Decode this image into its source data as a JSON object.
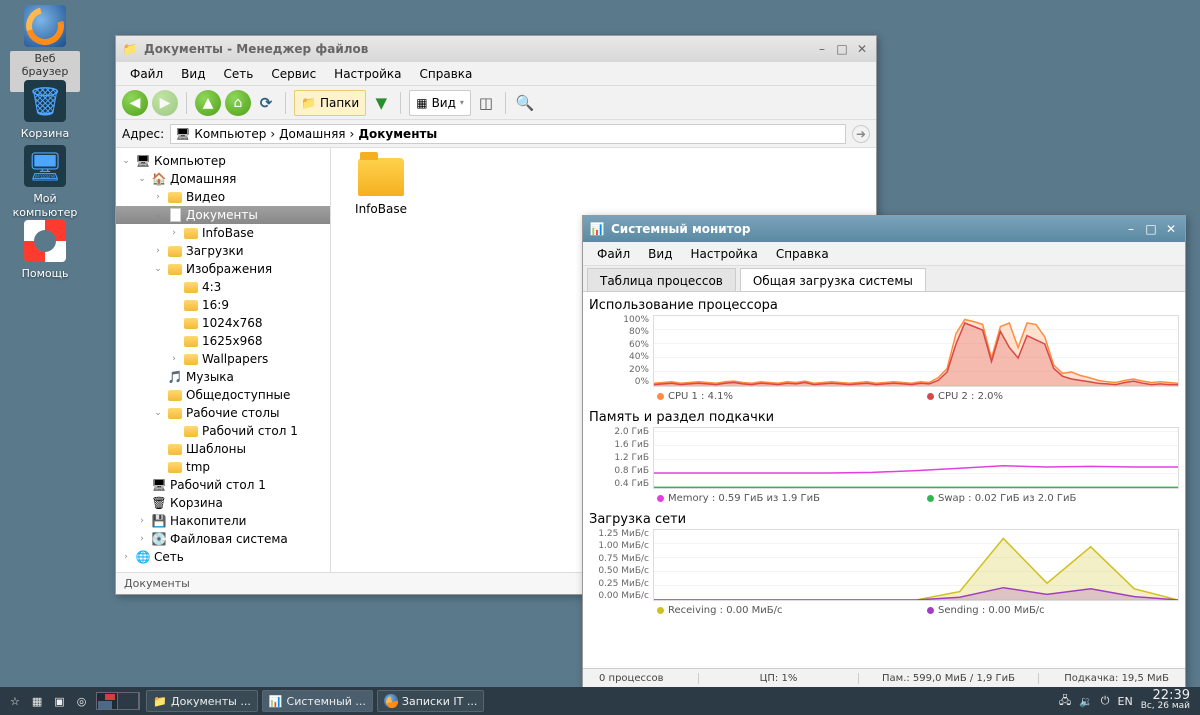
{
  "desktop_icons": [
    {
      "id": "firefox",
      "label": "Веб браузер\nFirefox",
      "selected": true
    },
    {
      "id": "trash",
      "label": "Корзина"
    },
    {
      "id": "computer",
      "label": "Мой\nкомпьютер"
    },
    {
      "id": "help",
      "label": "Помощь"
    }
  ],
  "fm": {
    "title": "Документы - Менеджер файлов",
    "menu": [
      "Файл",
      "Вид",
      "Сеть",
      "Сервис",
      "Настройка",
      "Справка"
    ],
    "folder_chip": "Папки",
    "view_chip": "Вид",
    "address_label": "Адрес:",
    "breadcrumb": [
      "Компьютер",
      "Домашняя",
      "Документы"
    ],
    "tree": [
      {
        "d": 0,
        "exp": "open",
        "icon": "comp",
        "label": "Компьютер"
      },
      {
        "d": 1,
        "exp": "open",
        "icon": "home",
        "label": "Домашняя"
      },
      {
        "d": 2,
        "exp": "closed",
        "icon": "folder",
        "label": "Видео"
      },
      {
        "d": 2,
        "exp": "open",
        "icon": "doc",
        "label": "Документы",
        "sel": true
      },
      {
        "d": 3,
        "exp": "closed",
        "icon": "folder",
        "label": "InfoBase"
      },
      {
        "d": 2,
        "exp": "closed",
        "icon": "folder",
        "label": "Загрузки"
      },
      {
        "d": 2,
        "exp": "open",
        "icon": "folder",
        "label": "Изображения"
      },
      {
        "d": 3,
        "exp": "leaf",
        "icon": "folder",
        "label": "4:3"
      },
      {
        "d": 3,
        "exp": "leaf",
        "icon": "folder",
        "label": "16:9"
      },
      {
        "d": 3,
        "exp": "leaf",
        "icon": "folder",
        "label": "1024x768"
      },
      {
        "d": 3,
        "exp": "leaf",
        "icon": "folder",
        "label": "1625x968"
      },
      {
        "d": 3,
        "exp": "closed",
        "icon": "folder",
        "label": "Wallpapers"
      },
      {
        "d": 2,
        "exp": "leaf",
        "icon": "music",
        "label": "Музыка"
      },
      {
        "d": 2,
        "exp": "leaf",
        "icon": "folder",
        "label": "Общедоступные"
      },
      {
        "d": 2,
        "exp": "open",
        "icon": "folder",
        "label": "Рабочие столы"
      },
      {
        "d": 3,
        "exp": "leaf",
        "icon": "folder",
        "label": "Рабочий стол 1"
      },
      {
        "d": 2,
        "exp": "leaf",
        "icon": "folder",
        "label": "Шаблоны"
      },
      {
        "d": 2,
        "exp": "leaf",
        "icon": "folder",
        "label": "tmp"
      },
      {
        "d": 1,
        "exp": "leaf",
        "icon": "desk",
        "label": "Рабочий стол 1"
      },
      {
        "d": 1,
        "exp": "leaf",
        "icon": "trash",
        "label": "Корзина"
      },
      {
        "d": 1,
        "exp": "closed",
        "icon": "drive",
        "label": "Накопители"
      },
      {
        "d": 1,
        "exp": "closed",
        "icon": "fs",
        "label": "Файловая система"
      },
      {
        "d": 0,
        "exp": "closed",
        "icon": "net",
        "label": "Сеть"
      }
    ],
    "files": [
      {
        "name": "InfoBase"
      }
    ],
    "status": "Документы"
  },
  "sm": {
    "title": "Системный монитор",
    "menu": [
      "Файл",
      "Вид",
      "Настройка",
      "Справка"
    ],
    "tabs": [
      "Таблица процессов",
      "Общая загрузка системы"
    ],
    "active_tab": 1,
    "cpu": {
      "title": "Использование процессора",
      "yticks": [
        "100%",
        "80%",
        "60%",
        "40%",
        "20%",
        "0%"
      ],
      "legend": [
        {
          "color": "#ff8c42",
          "label": "CPU 1 : 4.1%"
        },
        {
          "color": "#d94848",
          "label": "CPU 2 : 2.0%"
        }
      ]
    },
    "mem": {
      "title": "Память и раздел подкачки",
      "yticks": [
        "2.0 ГиБ",
        "1.6 ГиБ",
        "1.2 ГиБ",
        "0.8 ГиБ",
        "0.4 ГиБ"
      ],
      "legend": [
        {
          "color": "#e040e0",
          "label": "Memory : 0.59 ГиБ из 1.9 ГиБ"
        },
        {
          "color": "#2eb84f",
          "label": "Swap : 0.02 ГиБ из 2.0 ГиБ"
        }
      ]
    },
    "net": {
      "title": "Загрузка сети",
      "yticks": [
        "1.25 МиБ/с",
        "1.00 МиБ/с",
        "0.75 МиБ/с",
        "0.50 МиБ/с",
        "0.25 МиБ/с",
        "0.00 МиБ/с"
      ],
      "legend": [
        {
          "color": "#d0c020",
          "label": "Receiving : 0.00 МиБ/с"
        },
        {
          "color": "#a040c0",
          "label": "Sending : 0.00 МиБ/с"
        }
      ]
    },
    "status": {
      "procs": "0 процессов",
      "cpu": "ЦП: 1%",
      "mem": "Пам.: 599,0 МиБ / 1,9 ГиБ",
      "swap": "Подкачка: 19,5 МиБ"
    }
  },
  "taskbar": {
    "tasks": [
      {
        "icon": "doc",
        "label": "Документы ...",
        "active": false
      },
      {
        "icon": "mon",
        "label": "Системный ...",
        "active": true
      },
      {
        "icon": "ff",
        "label": "Записки IT ...",
        "active": false
      }
    ],
    "lang": "EN",
    "time": "22:39",
    "date": "Вс, 26 май"
  },
  "chart_data": [
    {
      "type": "line",
      "title": "Использование процессора",
      "ylabel": "%",
      "ylim": [
        0,
        100
      ],
      "x": [
        0,
        1,
        2,
        3,
        4,
        5,
        6,
        7,
        8,
        9,
        10,
        11,
        12,
        13,
        14,
        15,
        16,
        17,
        18,
        19,
        20,
        21,
        22,
        23,
        24,
        25,
        26,
        27,
        28,
        29,
        30,
        31,
        32,
        33,
        34,
        35,
        36,
        37,
        38,
        39,
        40,
        41,
        42,
        43,
        44,
        45,
        46,
        47,
        48,
        49,
        50,
        51,
        52,
        53,
        54,
        55,
        56,
        57,
        58,
        59
      ],
      "series": [
        {
          "name": "CPU 1",
          "color": "#ff8c42",
          "values": [
            4,
            5,
            6,
            4,
            5,
            6,
            5,
            4,
            6,
            7,
            5,
            4,
            6,
            5,
            4,
            6,
            5,
            7,
            4,
            5,
            6,
            5,
            4,
            5,
            6,
            4,
            5,
            6,
            5,
            4,
            6,
            5,
            12,
            25,
            75,
            95,
            92,
            88,
            40,
            85,
            90,
            55,
            90,
            88,
            70,
            30,
            18,
            20,
            15,
            12,
            8,
            6,
            5,
            8,
            10,
            7,
            5,
            6,
            5,
            4
          ]
        },
        {
          "name": "CPU 2",
          "color": "#d94848",
          "values": [
            2,
            3,
            4,
            2,
            3,
            4,
            3,
            2,
            4,
            5,
            3,
            2,
            4,
            3,
            2,
            4,
            3,
            5,
            2,
            3,
            4,
            3,
            2,
            3,
            4,
            2,
            3,
            4,
            3,
            2,
            4,
            3,
            8,
            20,
            60,
            90,
            85,
            80,
            35,
            78,
            55,
            40,
            72,
            66,
            60,
            25,
            14,
            10,
            8,
            6,
            4,
            3,
            2,
            5,
            7,
            4,
            2,
            3,
            2,
            2
          ]
        }
      ]
    },
    {
      "type": "line",
      "title": "Память и раздел подкачки",
      "ylabel": "ГиБ",
      "ylim": [
        0,
        2.0
      ],
      "x": [
        0,
        5,
        10,
        15,
        20,
        25,
        30,
        35,
        40,
        45,
        50,
        55,
        60
      ],
      "series": [
        {
          "name": "Memory",
          "color": "#e040e0",
          "values": [
            0.5,
            0.5,
            0.5,
            0.5,
            0.5,
            0.52,
            0.58,
            0.66,
            0.74,
            0.7,
            0.72,
            0.7,
            0.7
          ]
        },
        {
          "name": "Swap",
          "color": "#2eb84f",
          "values": [
            0.02,
            0.02,
            0.02,
            0.02,
            0.02,
            0.02,
            0.02,
            0.02,
            0.02,
            0.02,
            0.02,
            0.02,
            0.02
          ]
        }
      ]
    },
    {
      "type": "line",
      "title": "Загрузка сети",
      "ylabel": "МиБ/с",
      "ylim": [
        0,
        1.25
      ],
      "x": [
        0,
        5,
        10,
        15,
        20,
        25,
        30,
        35,
        40,
        45,
        50,
        55,
        60
      ],
      "series": [
        {
          "name": "Receiving",
          "color": "#d0c020",
          "values": [
            0,
            0,
            0,
            0,
            0,
            0,
            0,
            0.15,
            1.1,
            0.3,
            0.95,
            0.2,
            0.0
          ]
        },
        {
          "name": "Sending",
          "color": "#a040c0",
          "values": [
            0,
            0,
            0,
            0,
            0,
            0,
            0,
            0.05,
            0.22,
            0.1,
            0.2,
            0.06,
            0.0
          ]
        }
      ]
    }
  ]
}
